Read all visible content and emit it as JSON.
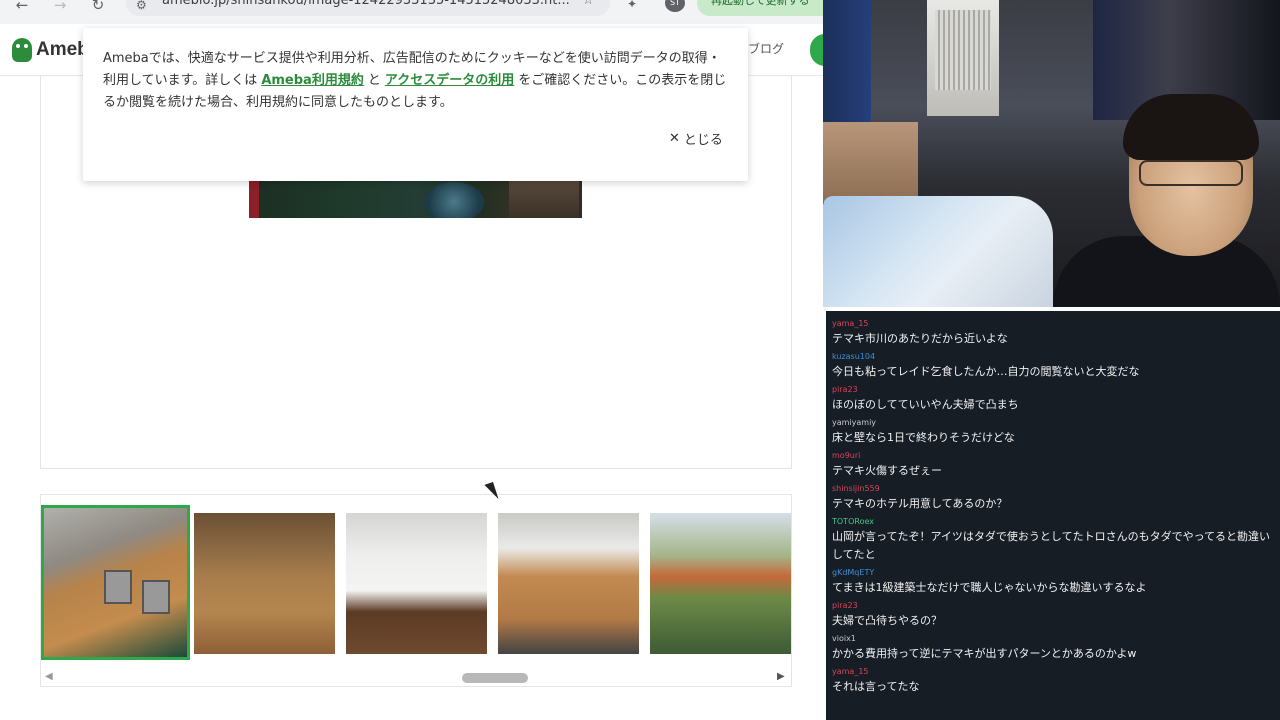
{
  "browser": {
    "url": "ameblo.jp/shinsankou/image-12422933135-14515248033.ht...",
    "update_button": "再起動して更新する",
    "avatar_label": "ST"
  },
  "header": {
    "logo_text": "Ameba",
    "blog_link": "ブログ"
  },
  "cookie_notice": {
    "text_before": "Amebaでは、快適なサービス提供や利用分析、広告配信のためにクッキーなどを使い訪問データの取得・利用しています。詳しくは",
    "link1": "Ameba利用規約",
    "text_middle": "と",
    "link2": "アクセスデータの利用",
    "text_after": "をご確認ください。この表示を閉じるか閲覧を続けた場合、利用規約に同意したものとします。",
    "close_label": "とじる"
  },
  "chat": {
    "messages": [
      {
        "user": "yama_15",
        "user_color": "#d9445a",
        "text": "テマキ市川のあたりだから近いよな"
      },
      {
        "user": "kuzasu104",
        "user_color": "#3d8fd9",
        "text": "今日も粘ってレイド乞食したんか…自力の閲覧ないと大変だな"
      },
      {
        "user": "pira23",
        "user_color": "#d9445a",
        "text": "ほのぼのしてていいやん夫婦で凸まち"
      },
      {
        "user": "yamiyamiy",
        "user_color": "#c9c9c9",
        "text": "床と壁なら1日で終わりそうだけどな"
      },
      {
        "user": "mo9uri",
        "user_color": "#d9445a",
        "text": "テマキ火傷するぜぇー"
      },
      {
        "user": "shinsijin559",
        "user_color": "#d9445a",
        "text": "テマキのホテル用意してあるのか？"
      },
      {
        "user": "TOTORoex",
        "user_color": "#3ec98c",
        "text": "山岡が言ってたぞ！アイツはタダで使おうとしてたトロさんのもタダでやってると勘違いしてたと"
      },
      {
        "user": "gKdMqETY",
        "user_color": "#3d8fd9",
        "text": "てまきは1級建築士なだけで職人じゃないからな勘違いするなよ"
      },
      {
        "user": "pira23",
        "user_color": "#d9445a",
        "text": "夫婦で凸待ちやるの？"
      },
      {
        "user": "vioix1",
        "user_color": "#c9c9c9",
        "text": "かかる費用持って逆にテマキが出すパターンとかあるのかよw"
      },
      {
        "user": "yama_15",
        "user_color": "#d9445a",
        "text": "それは言ってたな"
      }
    ]
  },
  "colors": {
    "accent": "#2ea84a",
    "link": "#2d8c3c",
    "chat_bg": "#171d25"
  }
}
